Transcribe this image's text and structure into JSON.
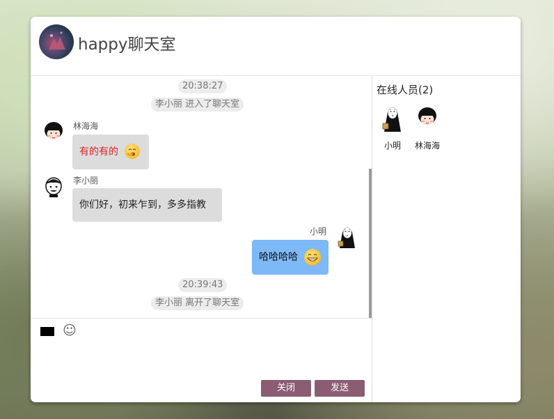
{
  "header": {
    "title": "happy聊天室"
  },
  "chat": {
    "messages": [
      {
        "type": "time",
        "text": "20:38:27"
      },
      {
        "type": "system",
        "text": "李小丽 进入了聊天室"
      },
      {
        "type": "incoming",
        "name": "林海海",
        "text": "有的有的",
        "text_color": "#e02020",
        "emoji": "yawning-face-emoji"
      },
      {
        "type": "incoming",
        "name": "李小丽",
        "text": "你们好，初来乍到，多多指教"
      },
      {
        "type": "outgoing",
        "name": "小明",
        "text": "哈哈哈哈",
        "emoji": "grinning-face-emoji"
      },
      {
        "type": "time",
        "text": "20:39:43"
      },
      {
        "type": "system",
        "text": "李小丽 离开了聊天室"
      }
    ]
  },
  "input": {
    "color_value": "#000000",
    "emoji_icon": "☺",
    "close_label": "关闭",
    "send_label": "发送"
  },
  "sidebar": {
    "title": "在线人员(2)",
    "users": [
      {
        "name": "小明",
        "avatar": "no-face-avatar"
      },
      {
        "name": "林海海",
        "avatar": "maruko-avatar"
      }
    ]
  },
  "colors": {
    "accent": "#8a5d73",
    "outgoing_bubble": "#7db8f7",
    "incoming_bubble": "#dcdcdc"
  }
}
